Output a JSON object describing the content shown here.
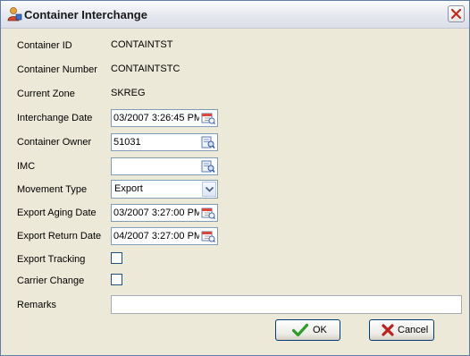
{
  "window": {
    "title": "Container Interchange"
  },
  "fields": {
    "container_id": {
      "label": "Container ID",
      "value": "CONTAINTST"
    },
    "container_number": {
      "label": "Container Number",
      "value": "CONTAINTSTC"
    },
    "current_zone": {
      "label": "Current Zone",
      "value": "SKREG"
    },
    "interchange_date": {
      "label": "Interchange Date",
      "value": "03/2007 3:26:45 PM"
    },
    "container_owner": {
      "label": "Container Owner",
      "value": "51031"
    },
    "imc": {
      "label": "IMC",
      "value": ""
    },
    "movement_type": {
      "label": "Movement Type",
      "value": "Export"
    },
    "export_aging_date": {
      "label": "Export Aging Date",
      "value": "03/2007 3:27:00 PM"
    },
    "export_return_date": {
      "label": "Export Return Date",
      "value": "04/2007 3:27:00 PM"
    },
    "export_tracking": {
      "label": "Export Tracking",
      "checked": false
    },
    "carrier_change": {
      "label": "Carrier Change",
      "checked": false
    },
    "remarks": {
      "label": "Remarks",
      "value": ""
    }
  },
  "buttons": {
    "ok": "OK",
    "cancel": "Cancel"
  },
  "icons": {
    "app": "app-user-icon",
    "close": "close-icon",
    "date_picker": "calendar-icon",
    "lookup": "lookup-icon",
    "dropdown": "chevron-down-icon",
    "ok": "check-icon",
    "cancel": "x-icon"
  },
  "colors": {
    "ok_check": "#2e9c2a",
    "cancel_x": "#c0201b",
    "close_x": "#c2281c"
  }
}
